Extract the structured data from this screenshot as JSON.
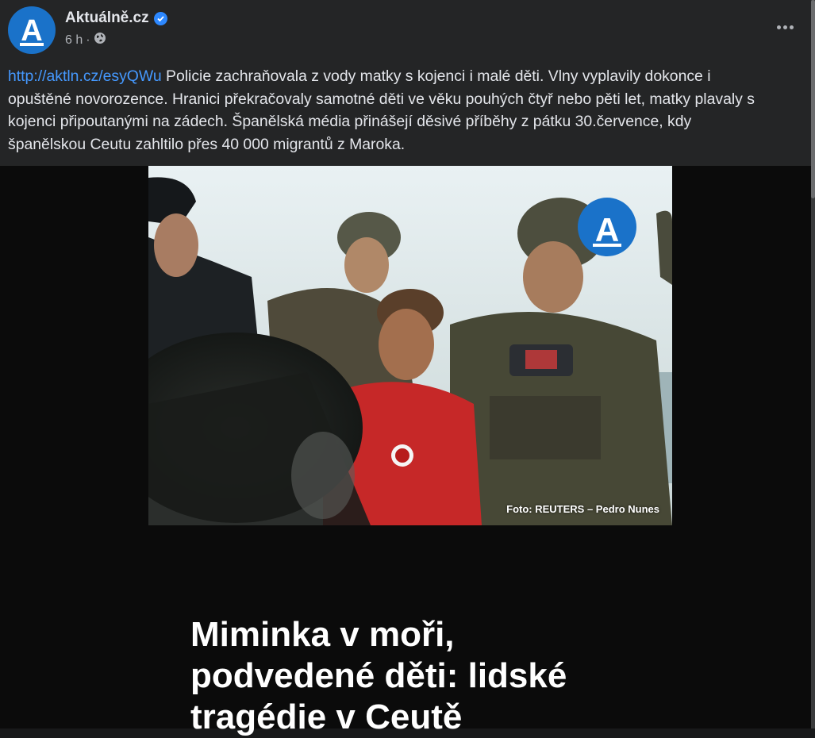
{
  "post": {
    "author": "Aktuálně.cz",
    "avatar_letter": "A",
    "time": "6 h",
    "separator": "·",
    "link": "http://aktln.cz/esyQWu",
    "text_line1": "Policie zachraňovala z vody matky s kojenci i malé děti. Vlny vyplavily dokonce i",
    "text_line2": "opuštěné novorozence. Hranici překračovaly samotné děti ve věku pouhých čtyř nebo pěti let, matky plavaly s",
    "text_line3": "kojenci připoutanými na zádech. Španělská média přinášejí děsivé příběhy z pátku 30.července, kdy",
    "text_line4": "španělskou Ceutu zahltilo přes 40 000 migrantů z Maroka."
  },
  "media": {
    "photo_logo_letter": "A",
    "credit": "Foto: REUTERS – Pedro Nunes",
    "headline_line1": "Miminka v moři,",
    "headline_line2": "podvedené děti: lidské",
    "headline_line3": "tragédie v Ceutě"
  },
  "icons": {
    "verified": "verified-badge-icon",
    "privacy": "globe-icon",
    "more": "more-options-icon"
  },
  "colors": {
    "background": "#242526",
    "link": "#4599ff",
    "brand_blue": "#1a72c9",
    "verified_blue": "#2d88ff"
  }
}
